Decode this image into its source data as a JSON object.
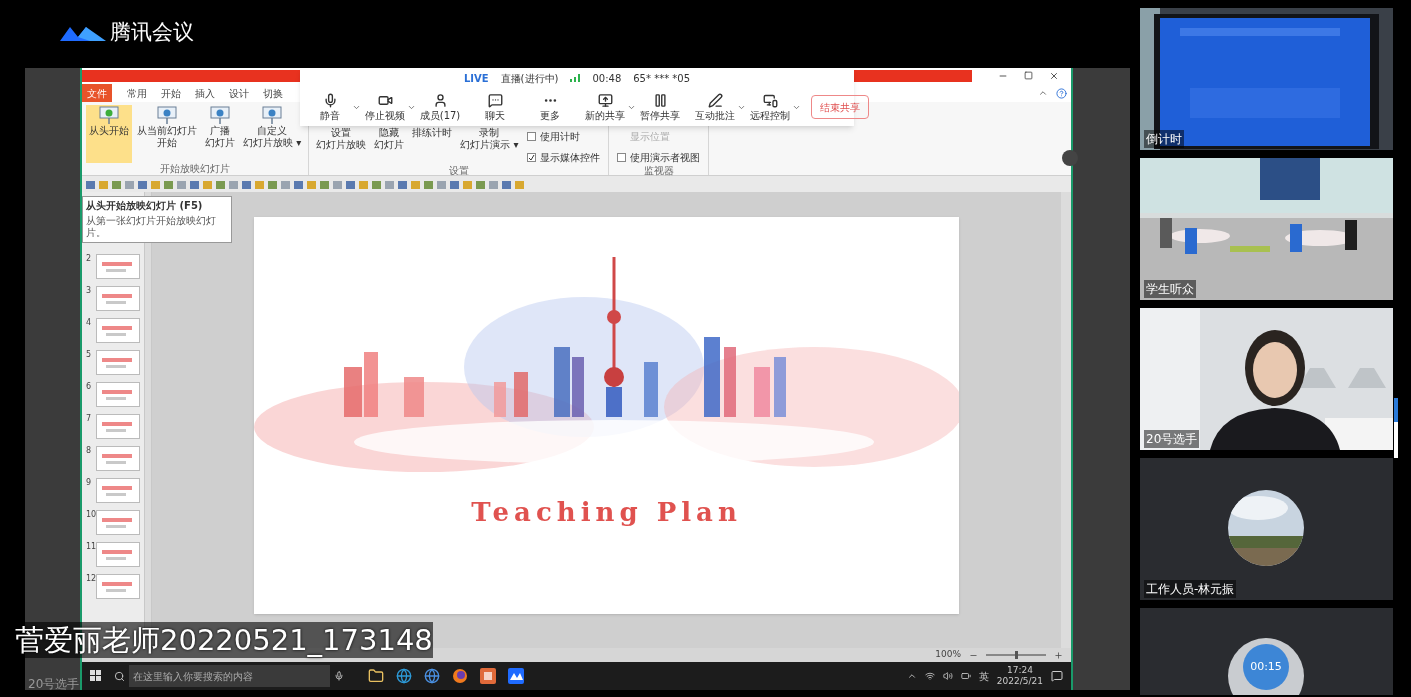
{
  "app": {
    "name": "腾讯会议"
  },
  "meeting_bar": {
    "live": "LIVE",
    "status": "直播(进行中)",
    "duration": "00:48",
    "meeting_id": "65* *** *05",
    "buttons": [
      {
        "label": "静音",
        "kind": "mic",
        "dropdown": true
      },
      {
        "label": "停止视频",
        "kind": "video",
        "dropdown": true
      },
      {
        "label": "成员(17)",
        "kind": "members",
        "dropdown": false
      },
      {
        "label": "聊天",
        "kind": "chat",
        "dropdown": false
      },
      {
        "label": "更多",
        "kind": "more",
        "dropdown": false
      },
      {
        "label": "新的共享",
        "kind": "share",
        "dropdown": true
      },
      {
        "label": "暂停共享",
        "kind": "pause",
        "dropdown": false
      },
      {
        "label": "互动批注",
        "kind": "annotate",
        "dropdown": true
      },
      {
        "label": "远程控制",
        "kind": "remote",
        "dropdown": true
      }
    ],
    "end_button": "结束共享"
  },
  "ppt": {
    "tabs": [
      {
        "label": "文件",
        "kind": "file"
      },
      {
        "label": "常用",
        "kind": "tab"
      },
      {
        "label": "开始",
        "kind": "tab"
      },
      {
        "label": "插入",
        "kind": "tab"
      },
      {
        "label": "设计",
        "kind": "tab"
      },
      {
        "label": "切换",
        "kind": "tab"
      }
    ],
    "ribbon_groups": [
      {
        "label": "开始放映幻灯片",
        "items": [
          {
            "kind": "large",
            "lines": [
              "从头开始"
            ],
            "highlighted": true
          },
          {
            "kind": "large",
            "lines": [
              "从当前幻灯片",
              "开始"
            ],
            "highlighted": false
          },
          {
            "kind": "large",
            "lines": [
              "广播",
              "幻灯片"
            ],
            "highlighted": false
          },
          {
            "kind": "large",
            "lines": [
              "自定义",
              "幻灯片放映 ▾"
            ],
            "highlighted": false
          }
        ]
      },
      {
        "label": "设置",
        "items": [
          {
            "kind": "large",
            "lines": [
              "设置",
              "幻灯片放映"
            ],
            "highlighted": false
          },
          {
            "kind": "large",
            "lines": [
              "隐藏",
              "幻灯片"
            ],
            "highlighted": false
          },
          {
            "kind": "large",
            "lines": [
              "排练计时"
            ],
            "highlighted": false
          },
          {
            "kind": "large",
            "lines": [
              "录制",
              "幻灯片演示 ▾"
            ],
            "highlighted": false
          },
          {
            "kind": "checks",
            "checks": [
              {
                "label": "使用计时",
                "checked": false
              },
              {
                "label": "显示媒体控件",
                "checked": true
              }
            ]
          }
        ]
      },
      {
        "label": "监视器",
        "items": [
          {
            "kind": "checks",
            "checks": [
              {
                "label": "显示位置",
                "disabled": true
              },
              {
                "label": "使用演示者视图",
                "checked": false
              }
            ]
          }
        ]
      }
    ],
    "tooltip": {
      "title": "从头开始放映幻灯片 (F5)",
      "body": "从第一张幻灯片开始放映幻灯片。"
    },
    "thumbnails": [
      {
        "number": "2"
      },
      {
        "number": "3"
      },
      {
        "number": "4"
      },
      {
        "number": "5"
      },
      {
        "number": "6"
      },
      {
        "number": "7"
      },
      {
        "number": "8"
      },
      {
        "number": "9"
      },
      {
        "number": "10"
      },
      {
        "number": "11"
      },
      {
        "number": "12"
      }
    ],
    "slide": {
      "title": "Teaching Plan"
    },
    "status_bar": {
      "zoom": "100%",
      "level": 0.5
    }
  },
  "taskbar": {
    "search_placeholder": "在这里输入你要搜索的内容",
    "ime": "英",
    "time": "17:24",
    "date": "2022/5/21"
  },
  "tiles": [
    {
      "name": "倒计时",
      "kind": "screen"
    },
    {
      "name": "学生听众",
      "kind": "room"
    },
    {
      "name": "20号选手",
      "kind": "person"
    },
    {
      "name": "工作人员-林元振",
      "kind": "avatar"
    },
    {
      "timer": "00:15",
      "kind": "timer"
    }
  ],
  "caption": "菅爱丽老师20220521_173148",
  "corner_label": "20号选手"
}
